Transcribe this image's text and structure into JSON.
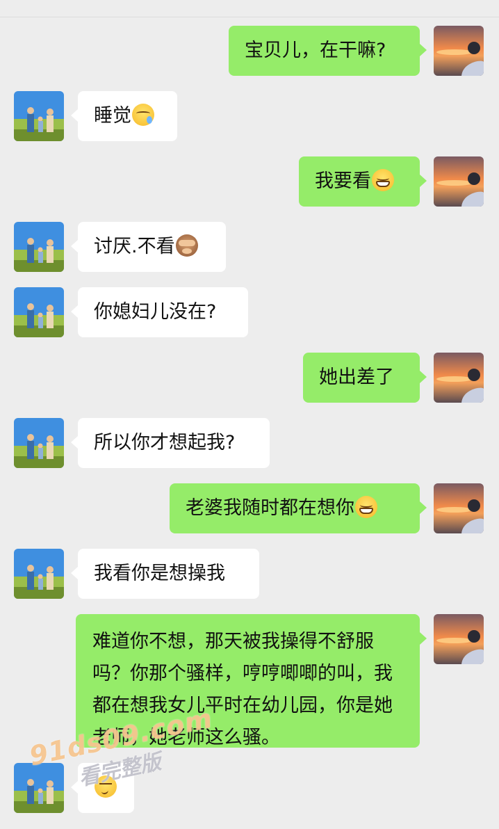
{
  "messages": [
    {
      "side": "out",
      "text": "宝贝儿，在干嘛?"
    },
    {
      "side": "in",
      "text": "睡觉",
      "emoji": "sleepy-face"
    },
    {
      "side": "out",
      "text": "我要看",
      "emoji": "grinning-face"
    },
    {
      "side": "in",
      "text": "讨厌.不看",
      "emoji": "see-no-evil-monkey"
    },
    {
      "side": "in",
      "text": "你媳妇儿没在?"
    },
    {
      "side": "out",
      "text": "她出差了"
    },
    {
      "side": "in",
      "text": "所以你才想起我?"
    },
    {
      "side": "out",
      "text": "老婆我随时都在想你",
      "emoji": "grinning-face"
    },
    {
      "side": "in",
      "text": "我看你是想操我"
    },
    {
      "side": "out",
      "text": "难道你不想，那天被我操得不舒服吗？你那个骚样，哼哼唧唧的叫，我都在想我女儿平时在幼儿园，你是她老师，她老师这么骚。"
    },
    {
      "side": "in",
      "text": "",
      "emoji": "smirking-face"
    }
  ],
  "watermark": {
    "url": "91ds09.com",
    "subtitle": "看完整版"
  },
  "colors": {
    "background": "#ededed",
    "outgoing_bubble": "#95ec69",
    "incoming_bubble": "#ffffff"
  }
}
